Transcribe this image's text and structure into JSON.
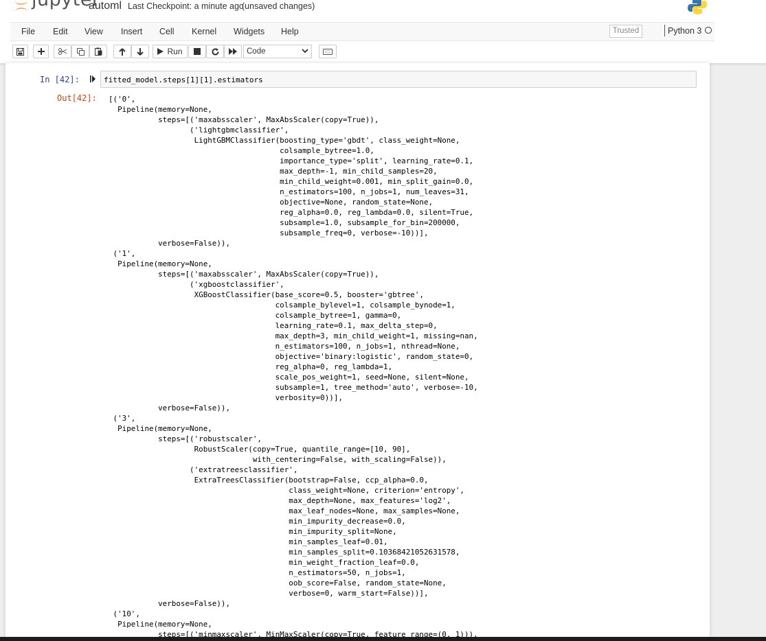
{
  "header": {
    "logo_text": "jupyter",
    "notebook_name": "automl",
    "checkpoint": "Last Checkpoint: a minute ago",
    "unsaved": "(unsaved changes)"
  },
  "menu": {
    "items": [
      "File",
      "Edit",
      "View",
      "Insert",
      "Cell",
      "Kernel",
      "Widgets",
      "Help"
    ],
    "trusted": "Trusted",
    "kernel_name": "Python 3"
  },
  "toolbar": {
    "run_label": "Run",
    "cell_type": "Code"
  },
  "cell": {
    "in_prompt": "In [42]:",
    "input_code": "fitted_model.steps[1][1].estimators",
    "out_prompt": "Out[42]:",
    "output_lines": [
      "[('0',",
      "  Pipeline(memory=None,",
      "           steps=[('maxabsscaler', MaxAbsScaler(copy=True)),",
      "                  ('lightgbmclassifier',",
      "                   LightGBMClassifier(boosting_type='gbdt', class_weight=None,",
      "                                      colsample_bytree=1.0,",
      "                                      importance_type='split', learning_rate=0.1,",
      "                                      max_depth=-1, min_child_samples=20,",
      "                                      min_child_weight=0.001, min_split_gain=0.0,",
      "                                      n_estimators=100, n_jobs=1, num_leaves=31,",
      "                                      objective=None, random_state=None,",
      "                                      reg_alpha=0.0, reg_lambda=0.0, silent=True,",
      "                                      subsample=1.0, subsample_for_bin=200000,",
      "                                      subsample_freq=0, verbose=-10))],",
      "           verbose=False)),",
      " ('1',",
      "  Pipeline(memory=None,",
      "           steps=[('maxabsscaler', MaxAbsScaler(copy=True)),",
      "                  ('xgboostclassifier',",
      "                   XGBoostClassifier(base_score=0.5, booster='gbtree',",
      "                                     colsample_bylevel=1, colsample_bynode=1,",
      "                                     colsample_bytree=1, gamma=0,",
      "                                     learning_rate=0.1, max_delta_step=0,",
      "                                     max_depth=3, min_child_weight=1, missing=nan,",
      "                                     n_estimators=100, n_jobs=1, nthread=None,",
      "                                     objective='binary:logistic', random_state=0,",
      "                                     reg_alpha=0, reg_lambda=1,",
      "                                     scale_pos_weight=1, seed=None, silent=None,",
      "                                     subsample=1, tree_method='auto', verbose=-10,",
      "                                     verbosity=0))],",
      "           verbose=False)),",
      " ('3',",
      "  Pipeline(memory=None,",
      "           steps=[('robustscaler',",
      "                   RobustScaler(copy=True, quantile_range=[10, 90],",
      "                                with_centering=False, with_scaling=False)),",
      "                  ('extratreesclassifier',",
      "                   ExtraTreesClassifier(bootstrap=False, ccp_alpha=0.0,",
      "                                        class_weight=None, criterion='entropy',",
      "                                        max_depth=None, max_features='log2',",
      "                                        max_leaf_nodes=None, max_samples=None,",
      "                                        min_impurity_decrease=0.0,",
      "                                        min_impurity_split=None,",
      "                                        min_samples_leaf=0.01,",
      "                                        min_samples_split=0.10368421052631578,",
      "                                        min_weight_fraction_leaf=0.0,",
      "                                        n_estimators=50, n_jobs=1,",
      "                                        oob_score=False, random_state=None,",
      "                                        verbose=0, warm_start=False))],",
      "           verbose=False)),",
      " ('10',",
      "  Pipeline(memory=None,",
      "           steps=[('minmaxscaler', MinMaxScaler(copy=True, feature_range=(0, 1))),"
    ]
  },
  "colors": {
    "in_prompt": "#303F9F",
    "out_prompt": "#D84315",
    "jupyter_orange": "#F37726"
  },
  "icons": [
    "jupyter-logo-icon",
    "python-logo-icon",
    "save-icon",
    "plus-icon",
    "cut-icon",
    "copy-icon",
    "paste-icon",
    "arrow-up-icon",
    "arrow-down-icon",
    "play-icon",
    "stop-icon",
    "restart-icon",
    "fast-forward-icon",
    "chevron-down-icon",
    "keyboard-icon",
    "run-marker-icon",
    "kernel-idle-icon"
  ]
}
